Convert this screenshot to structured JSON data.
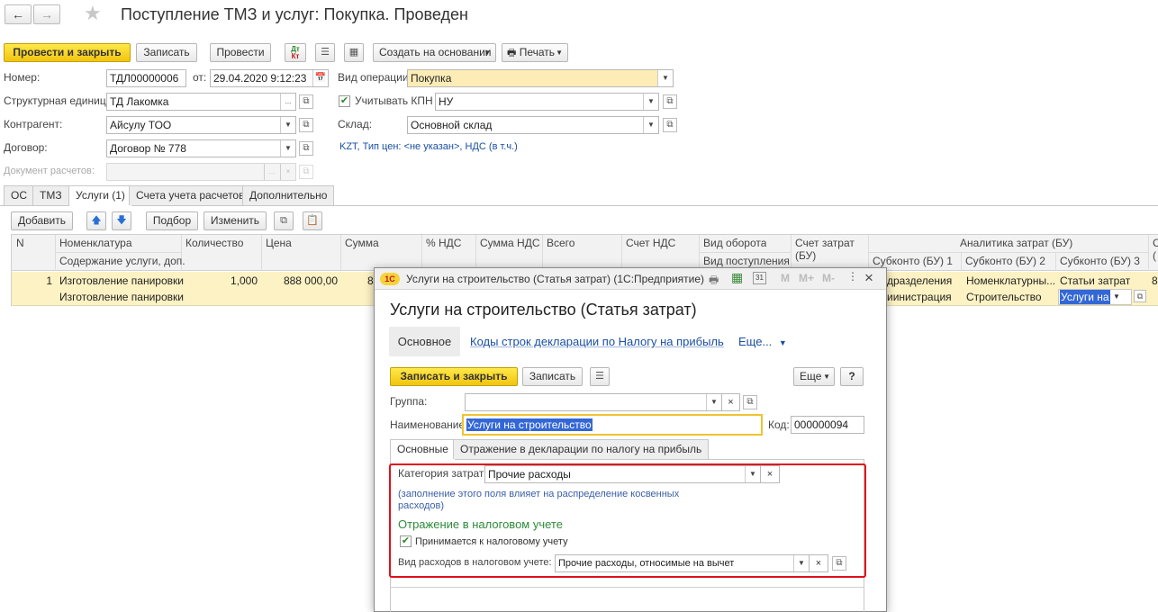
{
  "window": {
    "title": "Поступление ТМЗ и услуг: Покупка. Проведен"
  },
  "toolbar": {
    "post_close": "Провести и закрыть",
    "save": "Записать",
    "post": "Провести",
    "dtkt_icon_text_top": "Дт",
    "dtkt_icon_text_bottom": "Кт",
    "create_based": "Создать на основании",
    "print": "Печать"
  },
  "header": {
    "number_label": "Номер:",
    "number": "ТДЛ00000006",
    "from_label": "от:",
    "date": "29.04.2020  9:12:23",
    "operation_label": "Вид операции:",
    "operation": "Покупка",
    "unit_label": "Структурная единица:",
    "unit": "ТД Лакомка",
    "kpn_label": "Учитывать КПН",
    "kpn": "НУ",
    "counterparty_label": "Контрагент:",
    "counterparty": "Айсулу ТОО",
    "warehouse_label": "Склад:",
    "warehouse": "Основной склад",
    "contract_label": "Договор:",
    "contract": "Договор № 778",
    "price_info": "KZT, Тип цен: <не указан>, НДС (в т.ч.)",
    "settlement_doc_label": "Документ расчетов:"
  },
  "tabs": [
    "ОС",
    "ТМЗ",
    "Услуги (1)",
    "Счета учета расчетов",
    "Дополнительно"
  ],
  "table_toolbar": {
    "add": "Добавить",
    "select": "Подбор",
    "change": "Изменить"
  },
  "table": {
    "headers": {
      "n": "N",
      "nomenclature": "Номенклатура",
      "content": "Содержание услуги, доп.",
      "quantity": "Количество",
      "price": "Цена",
      "sum": "Сумма",
      "vat_pct": "% НДС",
      "vat_sum": "Сумма НДС",
      "total": "Всего",
      "vat_account": "Счет НДС",
      "turnover_type": "Вид оборота",
      "receipt_type": "Вид поступления",
      "cost_account": "Счет затрат",
      "cost_account_2": "(БУ)",
      "analytics": "Аналитика затрат (БУ)",
      "sub1": "Субконто (БУ) 1",
      "sub2": "Субконто (БУ) 2",
      "sub3": "Субконто (БУ) 3",
      "extra": "С",
      "extra2": "("
    },
    "row": {
      "n": "1",
      "nomenclature": "Изготовление панировки",
      "content": "Изготовление панировки",
      "quantity": "1,000",
      "price": "888 000,00",
      "sum_partial": "8",
      "sub1_a": "дразделения",
      "sub1_b": "иинистрация",
      "sub2_a": "Номенклатурны...",
      "sub2_b": "Строительство",
      "sub3_a": "Статьи затрат",
      "sub3_b": "Услуги на",
      "extra": "8"
    }
  },
  "dialog": {
    "title": "Услуги на строительство (Статья затрат)  (1С:Предприятие)",
    "calendar_num": "31",
    "m": "M",
    "m_plus": "M+",
    "m_minus": "M-",
    "heading": "Услуги на строительство (Статья затрат)",
    "nav_main": "Основное",
    "nav_codes": "Коды строк декларации по Налогу на прибыль",
    "nav_more": "Еще...",
    "save_close": "Записать и закрыть",
    "save": "Записать",
    "more": "Еще",
    "help": "?",
    "group_label": "Группа:",
    "group_value": "",
    "name_label": "Наименование:",
    "name_value": "Услуги на строительство",
    "code_label": "Код:",
    "code_value": "000000094",
    "tabs": [
      "Основные",
      "Отражение в декларации по налогу на прибыль"
    ],
    "category_label": "Категория затрат:",
    "category_value": "Прочие расходы",
    "hint": "(заполнение этого поля влияет на распределение косвенных расходов)",
    "tax_section": "Отражение в налоговом учете",
    "tax_checkbox": "Принимается к налоговому учету",
    "expense_type_label": "Вид расходов в налоговом учете:",
    "expense_type_value": "Прочие расходы, относимые на вычет"
  },
  "colors": {
    "accent_yellow": "#f5d21f",
    "field_yellow": "#fdecb6",
    "row_highlight": "#fdf2c4",
    "link_blue": "#1a4fa3",
    "green_section": "#2e8b3a",
    "red_frame": "#e0101c"
  },
  "icons": [
    "back-arrow-icon",
    "forward-arrow-icon",
    "star-icon",
    "dtkt-icon",
    "list-icon",
    "structure-icon",
    "print-icon",
    "up-arrow-icon",
    "down-arrow-icon",
    "copy-icon",
    "paste-icon",
    "calendar-icon",
    "open-icon",
    "close-icon",
    "checkmark-icon",
    "1c-logo-icon",
    "printer-icon",
    "calc-icon"
  ]
}
